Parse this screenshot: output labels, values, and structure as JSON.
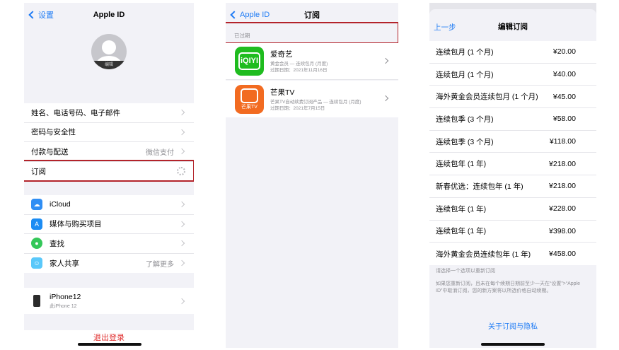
{
  "panel1": {
    "nav": {
      "back_label": "设置",
      "title": "Apple ID"
    },
    "avatar_edit": "编辑",
    "group1": [
      {
        "label": "姓名、电话号码、电子邮件",
        "value": ""
      },
      {
        "label": "密码与安全性",
        "value": ""
      },
      {
        "label": "付款与配送",
        "value": "微信支付"
      },
      {
        "label": "订阅",
        "value": ""
      }
    ],
    "group2": [
      {
        "label": "iCloud",
        "value": "",
        "icon": "icloud-icon",
        "color": "#2f8ef4"
      },
      {
        "label": "媒体与购买项目",
        "value": "",
        "icon": "app-store-icon",
        "color": "#1c8cf3"
      },
      {
        "label": "查找",
        "value": "",
        "icon": "find-my-icon",
        "color": "#34c759"
      },
      {
        "label": "家人共享",
        "value": "了解更多",
        "icon": "family-sharing-icon",
        "color": "#5ac8fa"
      }
    ],
    "device": {
      "name": "iPhone12",
      "subtitle": "此iPhone 12"
    },
    "logout_label": "退出登录"
  },
  "panel2": {
    "nav": {
      "back_label": "Apple ID",
      "title": "订阅"
    },
    "section_title": "已过期",
    "subscriptions": [
      {
        "name": "爱奇艺",
        "line1": "黄金会员 — 连续包月 (月度)",
        "line2": "过期日期：2021年11月16日",
        "icon": "iqiyi-icon",
        "color": "#1fbc1f",
        "icon_text": "iQIYI"
      },
      {
        "name": "芒果TV",
        "line1": "芒果TV自动续费订阅产品 — 连续包月 (月度)",
        "line2": "过期日期：2021年7月15日",
        "icon": "mango-tv-icon",
        "color": "#f26b21",
        "icon_text": "芒果TV"
      }
    ]
  },
  "panel3": {
    "back_label": "上一步",
    "title": "编辑订阅",
    "plans": [
      {
        "name": "连续包月 (1 个月)",
        "price": "¥20.00"
      },
      {
        "name": "连续包月 (1 个月)",
        "price": "¥40.00"
      },
      {
        "name": "海外黄金会员连续包月 (1 个月)",
        "price": "¥45.00"
      },
      {
        "name": "连续包季 (3 个月)",
        "price": "¥58.00"
      },
      {
        "name": "连续包季 (3 个月)",
        "price": "¥118.00"
      },
      {
        "name": "连续包年 (1 年)",
        "price": "¥218.00"
      },
      {
        "name": "新春优选：连续包年 (1 年)",
        "price": "¥218.00"
      },
      {
        "name": "连续包年 (1 年)",
        "price": "¥228.00"
      },
      {
        "name": "连续包年 (1 年)",
        "price": "¥398.00"
      },
      {
        "name": "海外黄金会员连续包年 (1 年)",
        "price": "¥458.00"
      }
    ],
    "footnote1": "请选择一个选项以重新订阅",
    "footnote2": "如果您重新订阅，且未在每个续期日期前至少一天在“设置”>“Apple ID”中取消订阅，您的新方案将以所选价格自动续期。",
    "privacy_link": "关于订阅与隐私"
  },
  "colors": {
    "accent": "#1f7cf5",
    "highlight": "#b3232a",
    "destructive": "#e0302f"
  }
}
